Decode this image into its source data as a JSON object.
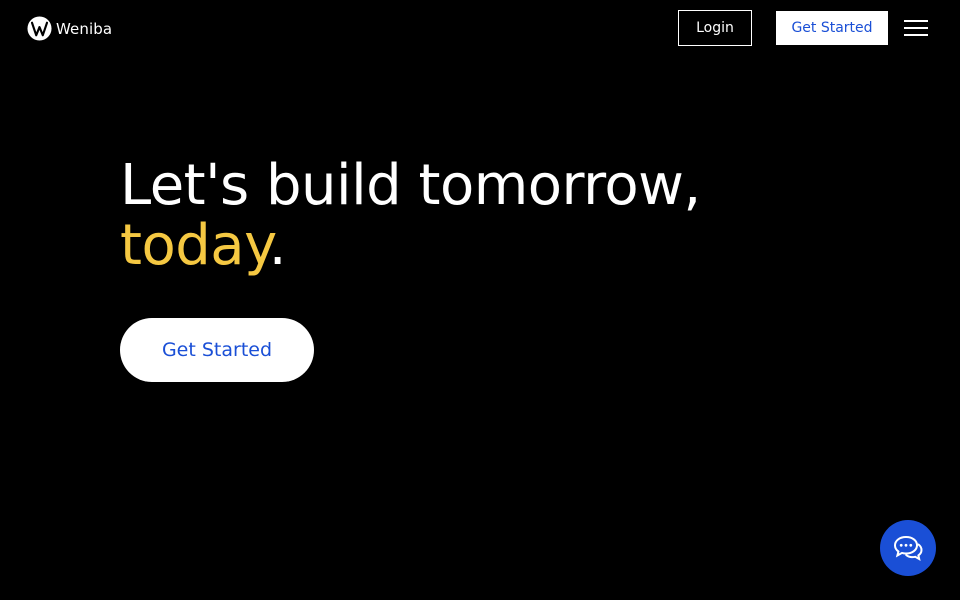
{
  "header": {
    "brand_name": "Weniba",
    "login_label": "Login",
    "get_started_label": "Get Started",
    "menu_icon": "hamburger-menu-icon"
  },
  "hero": {
    "title_line1": "Let's build tomorrow,",
    "title_accent": "today",
    "title_period": ".",
    "cta_label": "Get Started"
  },
  "chat": {
    "icon": "chat-bubbles-icon"
  },
  "colors": {
    "background": "#000000",
    "accent_yellow": "#f5c842",
    "brand_blue": "#1a4fd6",
    "text": "#ffffff"
  }
}
